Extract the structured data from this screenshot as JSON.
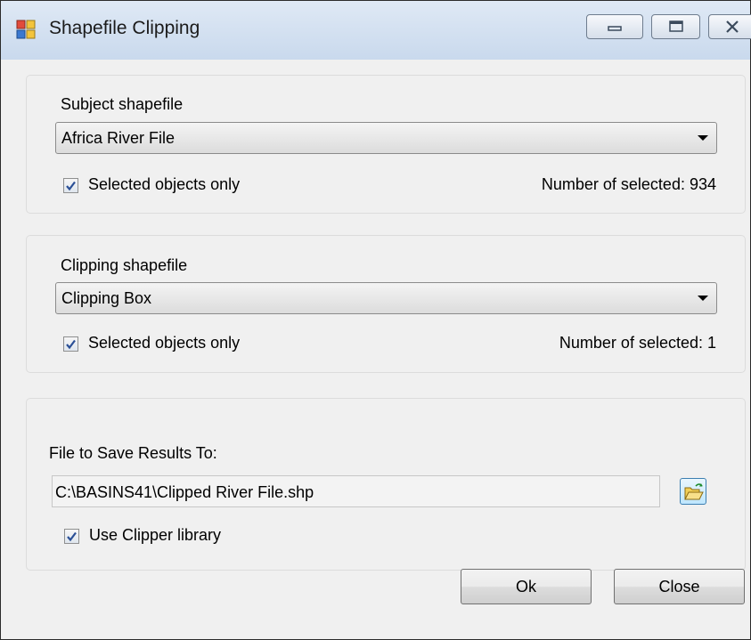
{
  "window": {
    "title": "Shapefile Clipping",
    "controls": [
      "minimize-icon",
      "maximize-icon",
      "close-icon"
    ]
  },
  "subject": {
    "label": "Subject shapefile",
    "selected_layer": "Africa River File",
    "selected_only_label": "Selected objects only",
    "selected_only_checked": true,
    "count_text": "Number of selected: 934"
  },
  "clipping": {
    "label": "Clipping shapefile",
    "selected_layer": "Clipping Box",
    "selected_only_label": "Selected objects only",
    "selected_only_checked": true,
    "count_text": "Number of selected: 1"
  },
  "output": {
    "label": "File to Save Results To:",
    "path": "C:\\BASINS41\\Clipped River File.shp",
    "browse_icon": "open-folder-icon",
    "clipper_label": "Use Clipper library",
    "clipper_checked": true
  },
  "buttons": {
    "ok": "Ok",
    "close": "Close"
  },
  "colors": {
    "window_bg": "#f0f0f0",
    "titlebar": "#c9d9ed",
    "checkmark": "#2a4f96"
  }
}
